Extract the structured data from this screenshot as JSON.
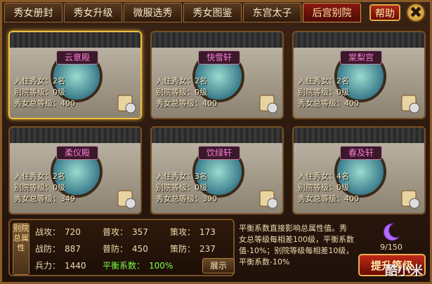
{
  "tabs": [
    {
      "label": "秀女册封",
      "active": false
    },
    {
      "label": "秀女升级",
      "active": false
    },
    {
      "label": "微服选秀",
      "active": false
    },
    {
      "label": "秀女图鉴",
      "active": false
    },
    {
      "label": "东宫太子",
      "active": false
    },
    {
      "label": "后宫别院",
      "active": true
    }
  ],
  "help_label": "帮助",
  "close_label": "✖",
  "villas": [
    {
      "name": "云意殿",
      "residents": "入住秀女：2名",
      "level": "别院等级：0级",
      "total": "秀女总等级：400",
      "selected": true
    },
    {
      "name": "快雪轩",
      "residents": "入住秀女：2名",
      "level": "别院等级：0级",
      "total": "秀女总等级：400",
      "selected": false
    },
    {
      "name": "棠梨宫",
      "residents": "入住秀女：2名",
      "level": "别院等级：0级",
      "total": "秀女总等级：400",
      "selected": false
    },
    {
      "name": "柔仪殿",
      "residents": "入住秀女：2名",
      "level": "别院等级：0级",
      "total": "秀女总等级：349",
      "selected": false
    },
    {
      "name": "饮绿轩",
      "residents": "入住秀女：3名",
      "level": "别院等级：0级",
      "total": "秀女总等级：390",
      "selected": false
    },
    {
      "name": "春及轩",
      "residents": "入住秀女：4名",
      "level": "别院等级：0级",
      "total": "秀女总等级：400",
      "selected": false
    }
  ],
  "panel": {
    "vertical_label": "别院总属性",
    "stats": [
      {
        "key": "战攻：",
        "value": "720"
      },
      {
        "key": "普攻：",
        "value": "357"
      },
      {
        "key": "策攻：",
        "value": "173"
      },
      {
        "key": "战防：",
        "value": "887"
      },
      {
        "key": "普防：",
        "value": "450"
      },
      {
        "key": "策防：",
        "value": "237"
      },
      {
        "key": "兵力：",
        "value": "1440"
      },
      {
        "key": "平衡系数：",
        "value": "100%"
      }
    ],
    "show_label": "展示"
  },
  "description": "平衡系数直接影响总属性值。秀女总等级每相差100级，平衡系数值-10%；别院等级每相差10级，平衡系数-10%",
  "moon_count": "9/150",
  "upgrade_label": "提升等级",
  "watermark": "酷小米",
  "colors": {
    "accent": "#f0c040",
    "plaque_text": "#ff7ad8",
    "balance_green": "#7cff4a"
  },
  "icons": {
    "villa": "scroll-icon",
    "moon": "moon-icon"
  }
}
